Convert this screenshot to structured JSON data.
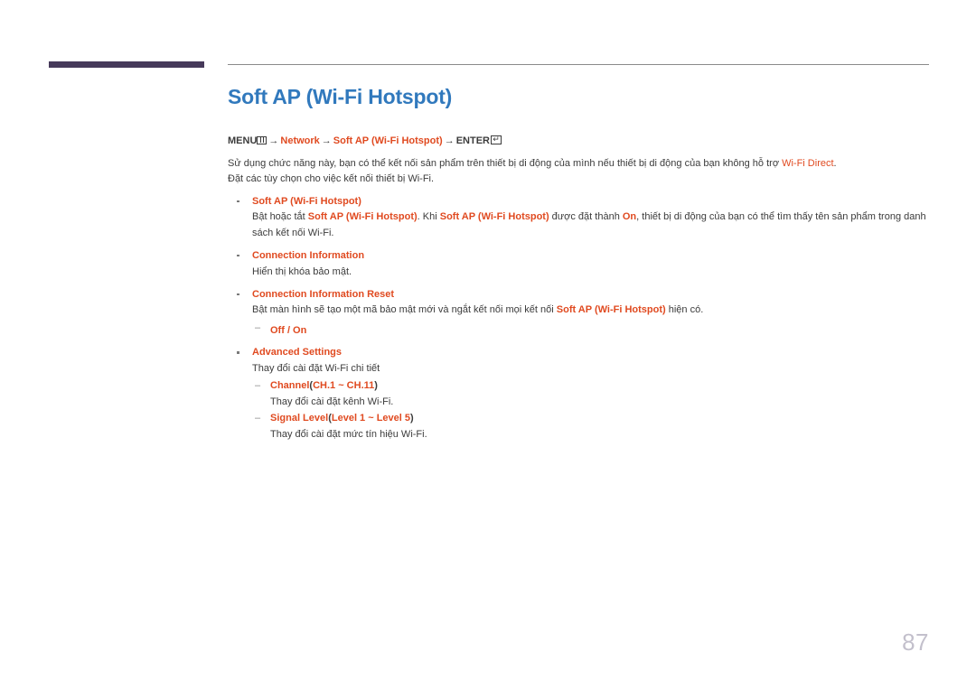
{
  "page": {
    "number": "87",
    "title": "Soft AP (Wi-Fi Hotspot)"
  },
  "menu_path": {
    "menu_label": "MENU",
    "menu_icon": "menu-keypad-icon",
    "arrow": "→",
    "segment_network": "Network",
    "segment_soft_ap": "Soft AP (Wi-Fi Hotspot)",
    "enter_label": "ENTER",
    "enter_icon": "return-arrow-icon",
    "enter_glyph": "↵"
  },
  "intro": {
    "line1_part1": "Sử dụng chức năng này, bạn có thể kết nối sản phẩm trên thiết bị di động của mình nếu thiết bị di động của bạn không hỗ trợ ",
    "line1_accent": "Wi-Fi Direct",
    "line1_part2": ".",
    "line2": "Đặt các tùy chọn cho việc kết nối thiết bị Wi-Fi."
  },
  "items": {
    "soft_ap": {
      "title": "Soft AP (Wi-Fi Hotspot)",
      "desc_p1": "Bật hoặc tắt ",
      "desc_a1": "Soft AP (Wi-Fi Hotspot)",
      "desc_p2": ". Khi ",
      "desc_a2": "Soft AP (Wi-Fi Hotspot)",
      "desc_p3": " được đặt thành ",
      "desc_a3": "On",
      "desc_p4": ", thiết bị di động của bạn có thể tìm thấy tên sản phẩm trong danh sách kết nối Wi-Fi."
    },
    "connection_information": {
      "title": "Connection Information",
      "desc": "Hiển thị khóa bảo mật."
    },
    "connection_information_reset": {
      "title": "Connection Information Reset",
      "desc_p1": "Bật màn hình sẽ tạo một mã bảo mật mới và ngắt kết nối mọi kết nối ",
      "desc_a1": "Soft AP (Wi-Fi Hotspot)",
      "desc_p2": " hiện có.",
      "options": "Off / On"
    },
    "advanced_settings": {
      "title": "Advanced Settings",
      "desc": "Thay đổi cài đặt Wi-Fi chi tiết",
      "sub": [
        {
          "name": "Channel",
          "range_open": "(",
          "range": "CH.1 ~ CH.11",
          "range_close": ")",
          "desc": "Thay đổi cài đặt kênh Wi-Fi."
        },
        {
          "name": "Signal Level",
          "range_open": "(",
          "range": "Level 1 ~ Level 5",
          "range_close": ")",
          "desc": "Thay đổi cài đặt mức tín hiệu Wi-Fi."
        }
      ]
    }
  },
  "colors": {
    "title_blue": "#3179bd",
    "accent_orange": "#e04a20",
    "deco_purple": "#46395a",
    "page_number_gray": "#c3c0cc",
    "body_text": "#3b3b3b"
  }
}
